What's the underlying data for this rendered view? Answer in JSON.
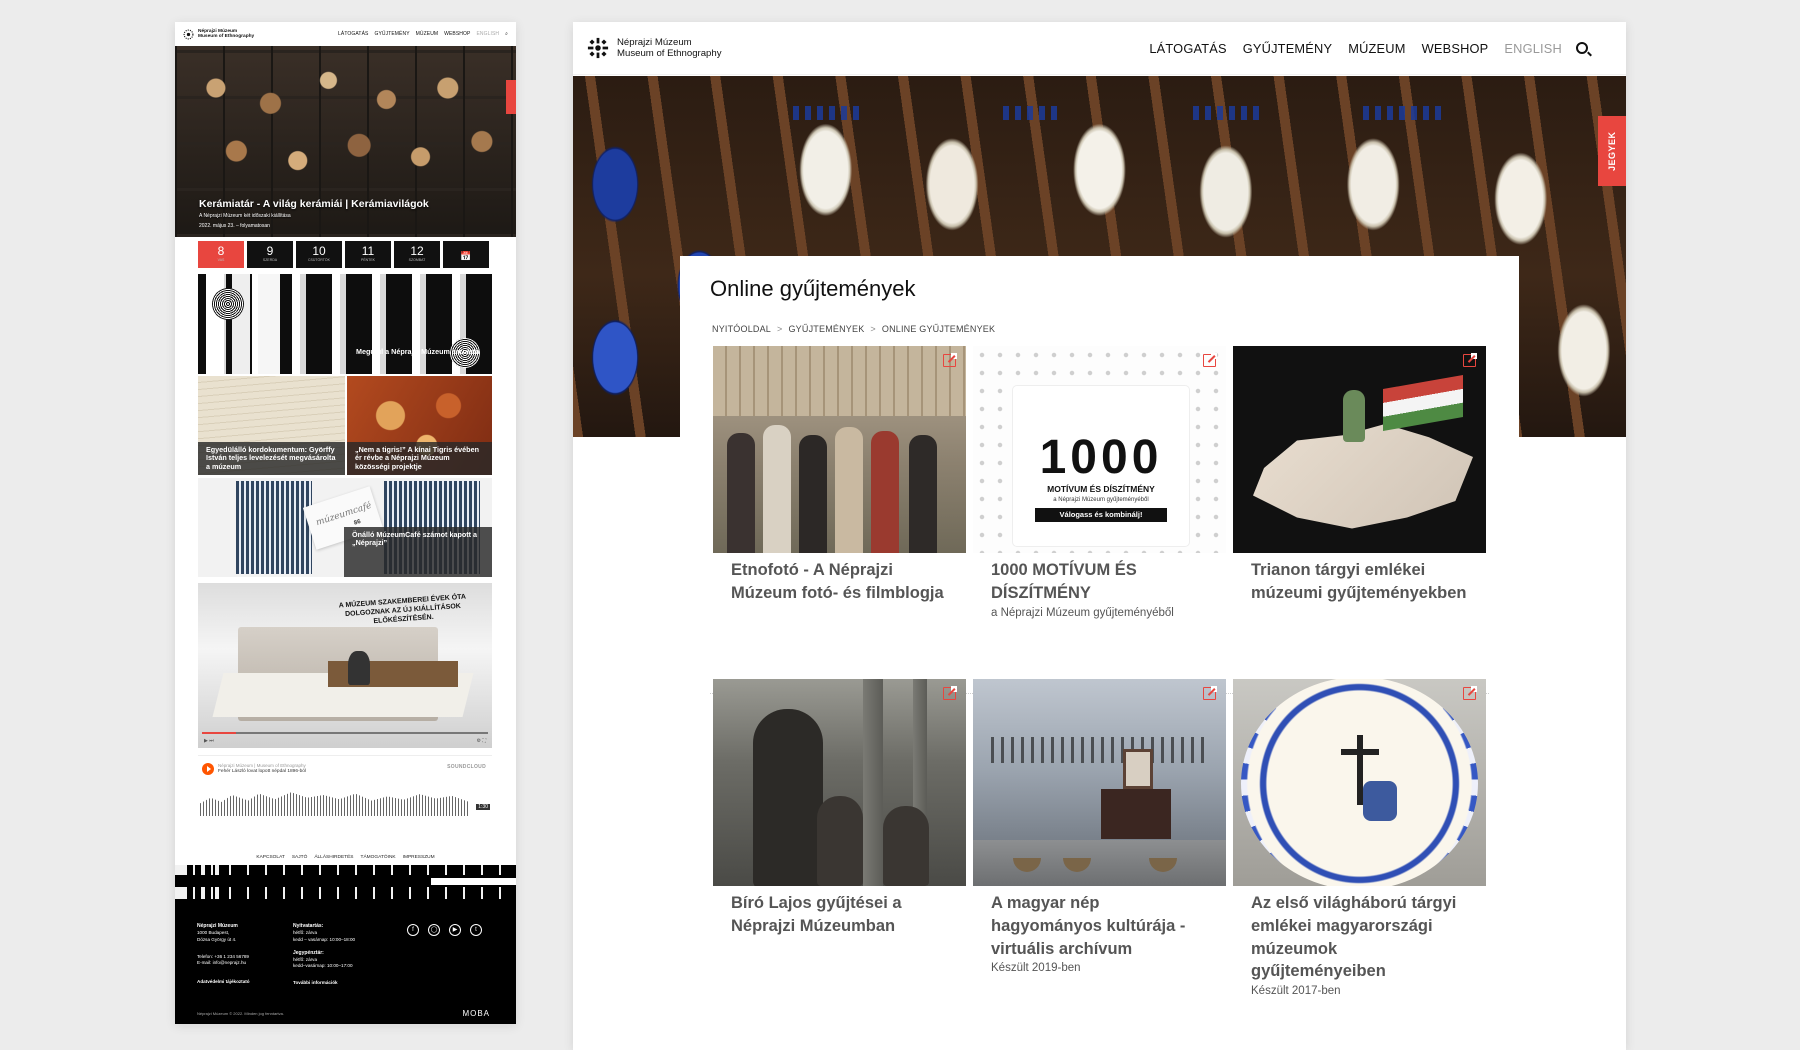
{
  "mobile": {
    "logo": {
      "line1": "Néprajzi Múzeum",
      "line2": "Museum of Ethnography"
    },
    "nav": [
      "LÁTOGATÁS",
      "GYŰJTEMÉNY",
      "MÚZEUM",
      "WEBSHOP",
      "ENGLISH"
    ],
    "hero": {
      "title": "Kerámiatár - A világ kerámiái | Kerámiavilágok",
      "subtitle": "A Néprajzi Múzeum két időszaki kiállítása",
      "date": "2022. május 23. – folyamatosan"
    },
    "calendar": [
      {
        "day": "8",
        "name": "VAS"
      },
      {
        "day": "9",
        "name": "SZERDA"
      },
      {
        "day": "10",
        "name": "CSÜTÖRTÖK"
      },
      {
        "day": "11",
        "name": "PÉNTEK"
      },
      {
        "day": "12",
        "name": "SZOMBAT"
      }
    ],
    "calendar_icon": "calendar-icon",
    "tiles": {
      "identity": "Megújul a Néprajzi Múzeum arculata",
      "document": "Egyedülálló kordokumentum: Györffy István teljes levelezését megvásárolta a múzeum",
      "tiger": "„Nem a tigris!” A kínai Tigris évében ér révbe a Néprajzi Múzeum közösségi projektje",
      "cafe_card": "múzeumcafé",
      "cafe_number": "86",
      "cafe": "Önálló MúzeumCafé számot kapott a „Néprajzi”"
    },
    "video": {
      "caption": "A MÚZEUM SZAKEMBEREI ÉVEK ÓTA DOLGOZNAK AZ ÚJ KIÁLLÍTÁSOK ELŐKÉSZÍTÉSÉN."
    },
    "soundcloud": {
      "account": "Néprajzi Múzeum | Museum of Ethnography",
      "track": "Fehér László lovat lopott népdal 1896-ból",
      "brand": "SOUNDCLOUD",
      "duration": "1:30"
    },
    "footer_nav": [
      "KAPCSOLAT",
      "SAJTÓ",
      "ÁLLÁSHIRDETÉS",
      "TÁMOGATÓINK",
      "IMPRESSZUM"
    ],
    "footer": {
      "col1": {
        "title": "Néprajzi Múzeum",
        "lines": [
          "1000 Budapest,",
          "Dózsa György út 4.",
          "Telefon: +36 1 234 56789",
          "E-mail: info@neprajz.hu",
          "Adatvédelmi tájékoztató"
        ]
      },
      "col2": {
        "title": "Nyitvatartás:",
        "lines": [
          "hétfő: zárva",
          "kedd – vasárnap: 10:00–18:00",
          "Jegypénztár:",
          "hétfő: zárva",
          "kedd–vasárnap: 10:00–17:00",
          "További információk"
        ]
      },
      "copyright": "Néprajzi Múzeum © 2022. Minden jog fenntartva.",
      "credit": "MOBA"
    }
  },
  "desktop": {
    "logo": {
      "line1": "Néprajzi Múzeum",
      "line2": "Museum of Ethnography"
    },
    "nav": [
      "LÁTOGATÁS",
      "GYŰJTEMÉNY",
      "MÚZEUM",
      "WEBSHOP",
      "ENGLISH"
    ],
    "ticket": "JEGYEK",
    "title": "Online gyűjtemények",
    "breadcrumb": [
      "NYITÓOLDAL",
      "GYŰJTEMÉNYEK",
      "ONLINE GYŰJTEMÉNYEK"
    ],
    "poster": {
      "number": "1000",
      "line1": "MOTÍVUM ÉS DÍSZÍTMÉNY",
      "line2": "a Néprajzi Múzeum gyűjteményéből",
      "line3": "Válogass és kombinálj!"
    },
    "items": [
      {
        "title": "Etnofotó - A Néprajzi Múzeum fotó- és filmblogja",
        "subtitle": ""
      },
      {
        "title": "1000 MOTÍVUM ÉS DÍSZÍTMÉNY",
        "subtitle": "a Néprajzi Múzeum gyűjteményéből"
      },
      {
        "title": "Trianon tárgyi emlékei múzeumi gyűjteményekben",
        "subtitle": ""
      },
      {
        "title": "Bíró Lajos gyűjtései a Néprajzi Múzeumban",
        "subtitle": ""
      },
      {
        "title": "A magyar nép hagyományos kultúrája - virtuális archívum",
        "subtitle": "Készült 2019-ben"
      },
      {
        "title": "Az első világháború tárgyi emlékei magyarországi múzeumok gyűjteményeiben",
        "subtitle": "Készült 2017-ben"
      }
    ],
    "accent_color": "#e8463f"
  }
}
